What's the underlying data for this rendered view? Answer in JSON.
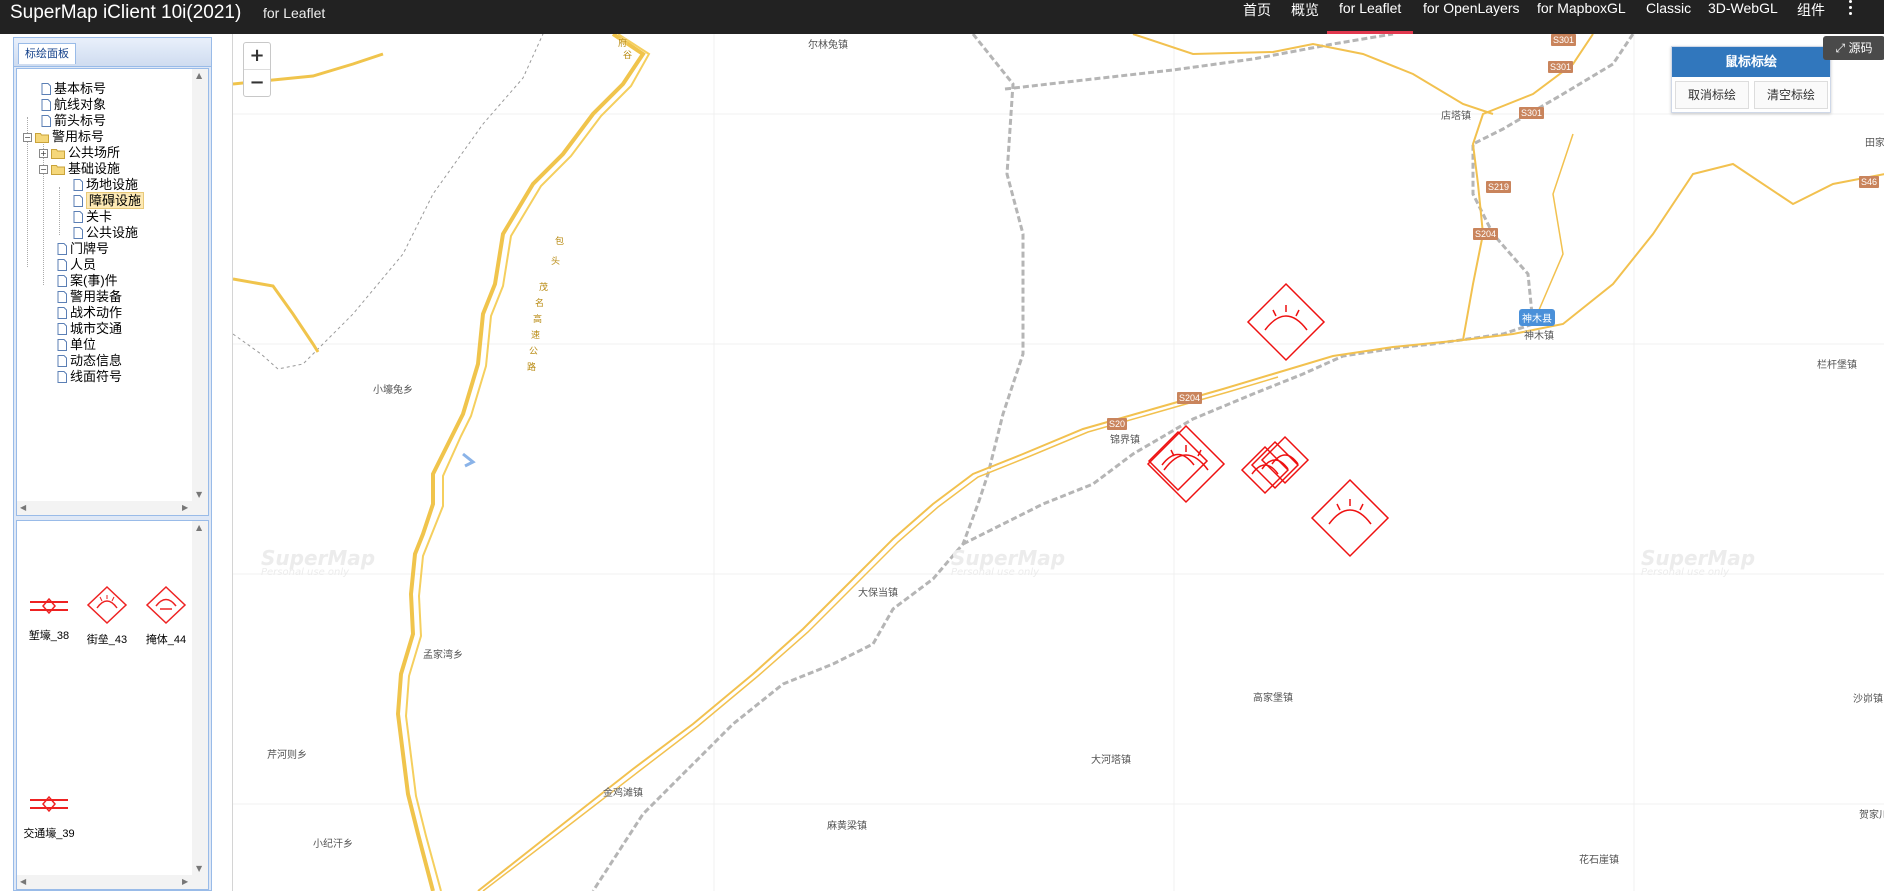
{
  "header": {
    "title": "SuperMap iClient 10i(2021)",
    "subtitle": "for Leaflet",
    "nav": [
      {
        "label": "首页",
        "active": false
      },
      {
        "label": "概览",
        "active": false
      },
      {
        "label": "for Leaflet",
        "active": true
      },
      {
        "label": "for OpenLayers",
        "active": false
      },
      {
        "label": "for MapboxGL",
        "active": false
      },
      {
        "label": "Classic",
        "active": false
      },
      {
        "label": "3D-WebGL",
        "active": false
      },
      {
        "label": "组件",
        "active": false
      }
    ]
  },
  "panel": {
    "tab_label": "标绘面板",
    "tree": [
      {
        "label": "基本标号"
      },
      {
        "label": "航线对象"
      },
      {
        "label": "箭头标号"
      },
      {
        "label": "警用标号"
      },
      {
        "label": "公共场所"
      },
      {
        "label": "基础设施"
      },
      {
        "label": "场地设施"
      },
      {
        "label": "障碍设施",
        "selected": true
      },
      {
        "label": "关卡"
      },
      {
        "label": "公共设施"
      },
      {
        "label": "门牌号"
      },
      {
        "label": "人员"
      },
      {
        "label": "案(事)件"
      },
      {
        "label": "警用装备"
      },
      {
        "label": "战术动作"
      },
      {
        "label": "城市交通"
      },
      {
        "label": "单位"
      },
      {
        "label": "动态信息"
      },
      {
        "label": "线面符号"
      }
    ],
    "symbols": [
      {
        "label": "堑壕_38",
        "icon": "trench-icon"
      },
      {
        "label": "街垒_43",
        "icon": "barricade-icon"
      },
      {
        "label": "掩体_44",
        "icon": "bunker-icon"
      },
      {
        "label": "交通壕_39",
        "icon": "communication-trench-icon"
      }
    ]
  },
  "map": {
    "zoom_in": "+",
    "zoom_out": "−",
    "source_button": "源码",
    "draw_panel": {
      "title": "鼠标标绘",
      "cancel": "取消标绘",
      "clear": "清空标绘"
    },
    "watermark": "SuperMap",
    "watermark_sub": "Personal use only",
    "places": [
      "尔林兔镇",
      "店塔镇",
      "田家",
      "栏杆堡镇",
      "神木镇",
      "小壕兔乡",
      "锦界镇",
      "大保当镇",
      "孟家湾乡",
      "高家堡镇",
      "沙峁镇",
      "芹河则乡",
      "大河塔镇",
      "金鸡滩镇",
      "麻黄梁镇",
      "贺家川",
      "小纪汗乡",
      "花石崖镇"
    ],
    "county_badge": "神木县",
    "road_shields": [
      "S301",
      "S301",
      "S301",
      "S219",
      "S204",
      "S46",
      "S204",
      "S20"
    ],
    "highway_chars": [
      "包",
      "头",
      "茂",
      "名",
      "高",
      "速",
      "公",
      "路",
      "府",
      "谷"
    ],
    "colors": {
      "symbol": "#ee1111",
      "road": "#f0c44c",
      "navbar": "#222222",
      "accent": "#3177bd"
    }
  }
}
